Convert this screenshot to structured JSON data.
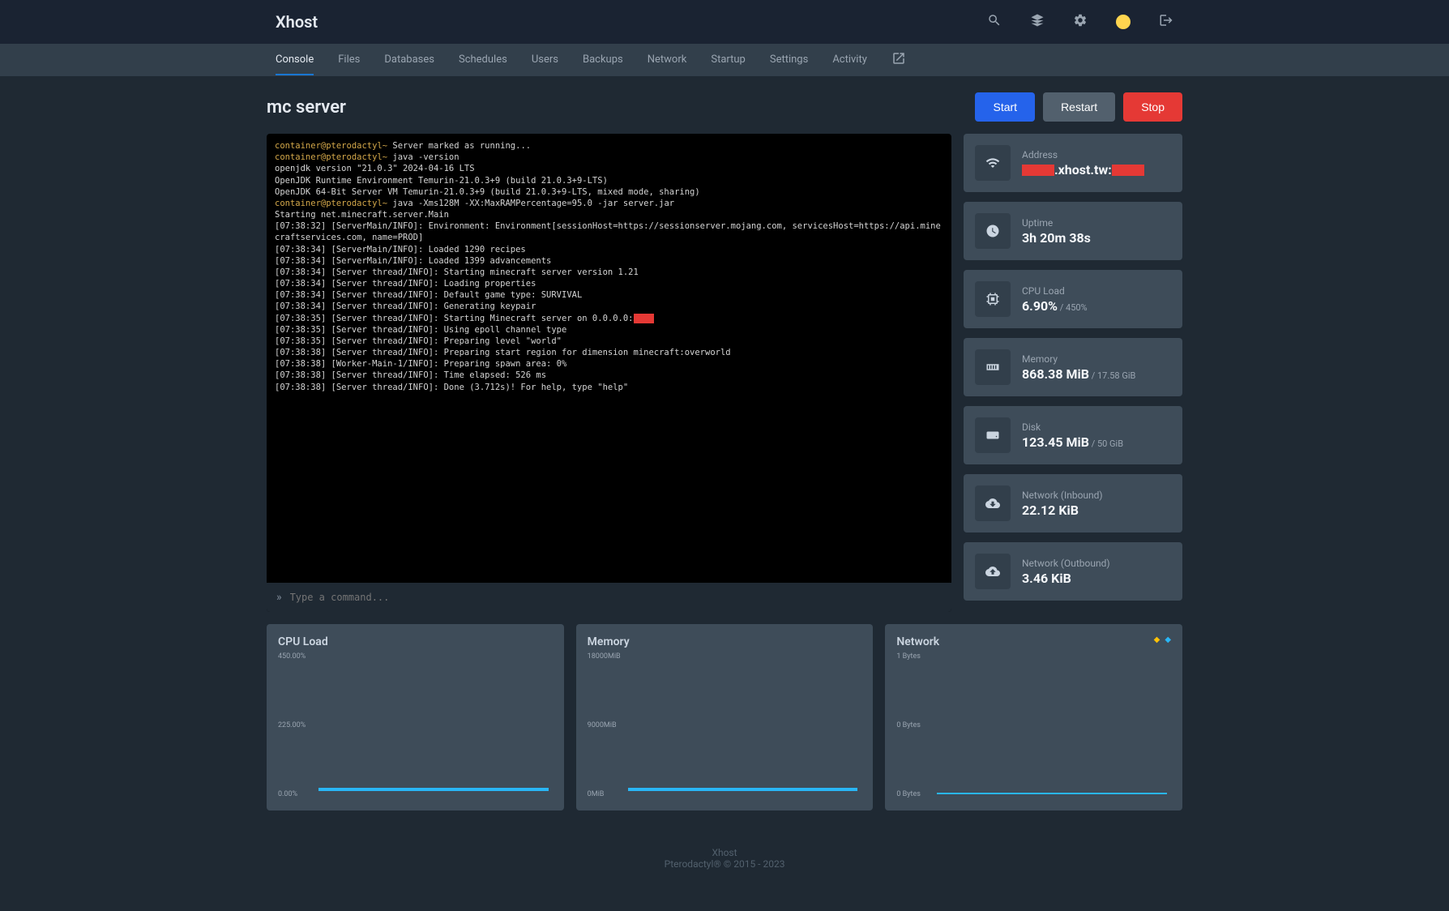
{
  "brand": "Xhost",
  "nav": [
    "Console",
    "Files",
    "Databases",
    "Schedules",
    "Users",
    "Backups",
    "Network",
    "Startup",
    "Settings",
    "Activity"
  ],
  "nav_active": 0,
  "server_name": "mc server",
  "buttons": {
    "start": "Start",
    "restart": "Restart",
    "stop": "Stop"
  },
  "console_lines": [
    {
      "t": "prompt",
      "v": "container@pterodactyl~"
    },
    {
      "t": "text",
      "v": " Server marked as running...\n"
    },
    {
      "t": "prompt",
      "v": "container@pterodactyl~"
    },
    {
      "t": "text",
      "v": " java -version\nopenjdk version \"21.0.3\" 2024-04-16 LTS\nOpenJDK Runtime Environment Temurin-21.0.3+9 (build 21.0.3+9-LTS)\nOpenJDK 64-Bit Server VM Temurin-21.0.3+9 (build 21.0.3+9-LTS, mixed mode, sharing)\n"
    },
    {
      "t": "prompt",
      "v": "container@pterodactyl~"
    },
    {
      "t": "text",
      "v": " java -Xms128M -XX:MaxRAMPercentage=95.0 -jar server.jar\nStarting net.minecraft.server.Main\n[07:38:32] [ServerMain/INFO]: Environment: Environment[sessionHost=https://sessionserver.mojang.com, servicesHost=https://api.minecraftservices.com, name=PROD]\n[07:38:34] [ServerMain/INFO]: Loaded 1290 recipes\n[07:38:34] [ServerMain/INFO]: Loaded 1399 advancements\n[07:38:34] [Server thread/INFO]: Starting minecraft server version 1.21\n[07:38:34] [Server thread/INFO]: Loading properties\n[07:38:34] [Server thread/INFO]: Default game type: SURVIVAL\n[07:38:34] [Server thread/INFO]: Generating keypair\n[07:38:35] [Server thread/INFO]: Starting Minecraft server on 0.0.0.0:"
    },
    {
      "t": "redact",
      "v": "XXXX"
    },
    {
      "t": "text",
      "v": "\n[07:38:35] [Server thread/INFO]: Using epoll channel type\n[07:38:35] [Server thread/INFO]: Preparing level \"world\"\n[07:38:38] [Server thread/INFO]: Preparing start region for dimension minecraft:overworld\n[07:38:38] [Worker-Main-1/INFO]: Preparing spawn area: 0%\n[07:38:38] [Server thread/INFO]: Time elapsed: 526 ms\n[07:38:38] [Server thread/INFO]: Done (3.712s)! For help, type \"help\"\n"
    }
  ],
  "console_placeholder": "Type a command...",
  "stats": {
    "address": {
      "label": "Address",
      "value_mid": ".xhost.tw:"
    },
    "uptime": {
      "label": "Uptime",
      "value": "3h 20m 38s"
    },
    "cpu": {
      "label": "CPU Load",
      "value": "6.90%",
      "sub": " / 450%"
    },
    "memory": {
      "label": "Memory",
      "value": "868.38 MiB",
      "sub": " / 17.58 GiB"
    },
    "disk": {
      "label": "Disk",
      "value": "123.45 MiB",
      "sub": " / 50 GiB"
    },
    "net_in": {
      "label": "Network (Inbound)",
      "value": "22.12 KiB"
    },
    "net_out": {
      "label": "Network (Outbound)",
      "value": "3.46 KiB"
    }
  },
  "charts": {
    "cpu": {
      "title": "CPU Load",
      "ticks": [
        "450.00%",
        "225.00%",
        "0.00%"
      ]
    },
    "memory": {
      "title": "Memory",
      "ticks": [
        "18000MiB",
        "9000MiB",
        "0MiB"
      ]
    },
    "network": {
      "title": "Network",
      "ticks": [
        "1 Bytes",
        "0 Bytes",
        "0 Bytes"
      ]
    }
  },
  "footer": {
    "line1": "Xhost",
    "line2": "Pterodactyl® © 2015 - 2023"
  },
  "chart_data": [
    {
      "type": "line",
      "title": "CPU Load",
      "ylabel": "%",
      "ylim": [
        0,
        450
      ],
      "series": [
        {
          "name": "cpu",
          "values": [
            6.9,
            6.9,
            6.9,
            6.9,
            6.9,
            6.9,
            6.9,
            6.9,
            6.9,
            6.9
          ]
        }
      ]
    },
    {
      "type": "line",
      "title": "Memory",
      "ylabel": "MiB",
      "ylim": [
        0,
        18000
      ],
      "series": [
        {
          "name": "memory",
          "values": [
            868,
            868,
            868,
            868,
            868,
            868,
            868,
            868,
            868,
            868
          ]
        }
      ]
    },
    {
      "type": "line",
      "title": "Network",
      "ylabel": "Bytes",
      "ylim": [
        0,
        1
      ],
      "series": [
        {
          "name": "inbound",
          "values": [
            0,
            0,
            0,
            0,
            0,
            0,
            0,
            0,
            0,
            0
          ]
        },
        {
          "name": "outbound",
          "values": [
            0,
            0,
            0,
            0,
            0,
            0,
            0,
            0,
            0,
            0
          ]
        }
      ]
    }
  ]
}
